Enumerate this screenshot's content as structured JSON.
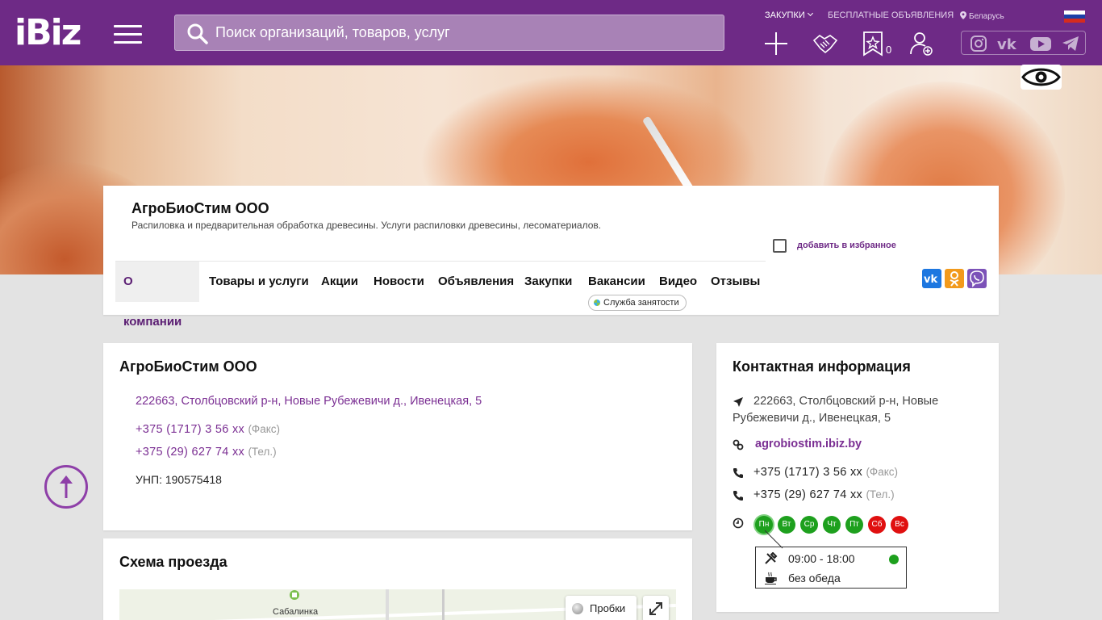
{
  "header": {
    "logo": "iBiz",
    "search_placeholder": "Поиск организаций, товаров, услуг",
    "nav_procurement": "ЗАКУПКИ",
    "nav_free_ads": "БЕСПЛАТНЫЕ ОБЪЯВЛЕНИЯ",
    "nav_region": "Беларусь",
    "favorites_count": "0",
    "icons": [
      "plus-icon",
      "handshake-icon",
      "star-bookmark-icon",
      "add-user-icon"
    ],
    "social_icons": [
      "instagram-icon",
      "vk-icon",
      "youtube-icon",
      "telegram-icon"
    ],
    "accent_color": "#6e2a86"
  },
  "company": {
    "name": "АгроБиоСтим ООО",
    "description": "Распиловка и предварительная обработка древесины. Услуги распиловки древесины, лесоматериалов.",
    "add_favorite": "добавить в избранное",
    "tabs": [
      "О компании",
      "Товары и услуги",
      "Акции",
      "Новости",
      "Объявления",
      "Закупки",
      "Вакансии",
      "Видео",
      "Отзывы"
    ],
    "active_tab": "О компании",
    "jobs_badge": "Служба занятости",
    "share_labels": [
      "VK",
      "OK",
      "Viber"
    ]
  },
  "info": {
    "title": "АгроБиоСтим ООО",
    "address": "222663, Столбцовский р-н, Новые Рубежевичи д., Ивенецкая, 5",
    "phones": [
      {
        "number": "+375 (1717) 3 56 xx",
        "kind": "(Факс)"
      },
      {
        "number": "+375 (29) 627 74 xx",
        "kind": "(Тел.)"
      }
    ],
    "unp": "УНП: 190575418"
  },
  "map_section": {
    "title": "Схема проезда",
    "traffic_label": "Пробки",
    "place_label": "Сабалинка"
  },
  "contacts": {
    "title": "Контактная информация",
    "address": "222663, Столбцовский р-н, Новые Рубежевичи д., Ивенецкая, 5",
    "site": "agrobiostim.ibiz.by",
    "phones": [
      {
        "number": "+375 (1717) 3 56 xx",
        "kind": "(Факс)"
      },
      {
        "number": "+375 (29) 627 74 xx",
        "kind": "(Тел.)"
      }
    ],
    "days": [
      {
        "label": "Пн",
        "open": true
      },
      {
        "label": "Вт",
        "open": true
      },
      {
        "label": "Ср",
        "open": true
      },
      {
        "label": "Чт",
        "open": true
      },
      {
        "label": "Пт",
        "open": true
      },
      {
        "label": "Сб",
        "open": false
      },
      {
        "label": "Вс",
        "open": false
      }
    ],
    "hours": "09:00 - 18:00",
    "lunch": "без обеда"
  }
}
